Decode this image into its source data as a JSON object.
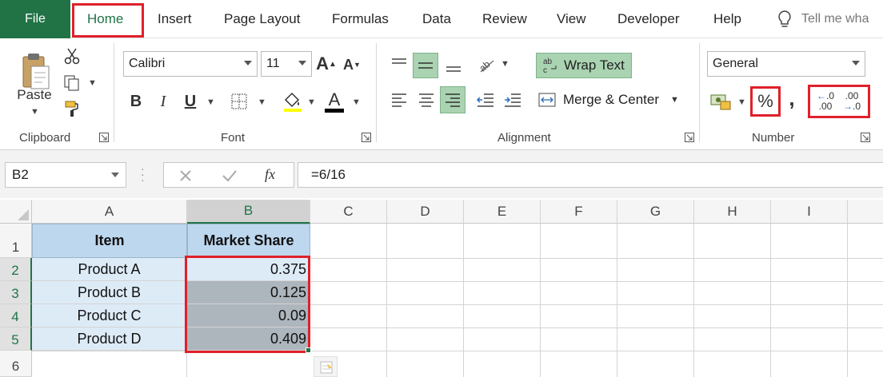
{
  "tabs": {
    "file": "File",
    "home": "Home",
    "insert": "Insert",
    "page_layout": "Page Layout",
    "formulas": "Formulas",
    "data": "Data",
    "review": "Review",
    "view": "View",
    "developer": "Developer",
    "help": "Help",
    "tell_me": "Tell me wha"
  },
  "ribbon": {
    "clipboard": {
      "label": "Clipboard",
      "paste": "Paste"
    },
    "font": {
      "label": "Font",
      "name": "Calibri",
      "size": "11",
      "bold": "B",
      "italic": "I",
      "underline": "U",
      "grow": "A",
      "shrink": "A",
      "font_color": "A"
    },
    "alignment": {
      "label": "Alignment",
      "wrap_text": "Wrap Text",
      "merge_center": "Merge & Center"
    },
    "number": {
      "label": "Number",
      "format": "General",
      "percent": "%",
      "comma": ",",
      "inc_dec_top": ".0",
      "inc_dec_bottom": ".00",
      "dec_dec_top": ".00",
      "dec_dec_bottom": ".0"
    }
  },
  "formula_bar": {
    "name_box": "B2",
    "fx": "fx",
    "formula": "=6/16"
  },
  "sheet": {
    "columns": [
      "A",
      "B",
      "C",
      "D",
      "E",
      "F",
      "G",
      "H",
      "I"
    ],
    "rows": [
      "1",
      "2",
      "3",
      "4",
      "5",
      "6"
    ],
    "header": {
      "item": "Item",
      "share": "Market Share"
    },
    "data": [
      {
        "item": "Product A",
        "share": "0.375"
      },
      {
        "item": "Product B",
        "share": "0.125"
      },
      {
        "item": "Product C",
        "share": "0.09"
      },
      {
        "item": "Product D",
        "share": "0.409"
      }
    ]
  },
  "colors": {
    "excel_green": "#217346",
    "highlight_red": "#e0202a",
    "header_fill": "#bdd7ee",
    "item_fill": "#ddebf7",
    "selection_fill": "#adb5bd"
  }
}
